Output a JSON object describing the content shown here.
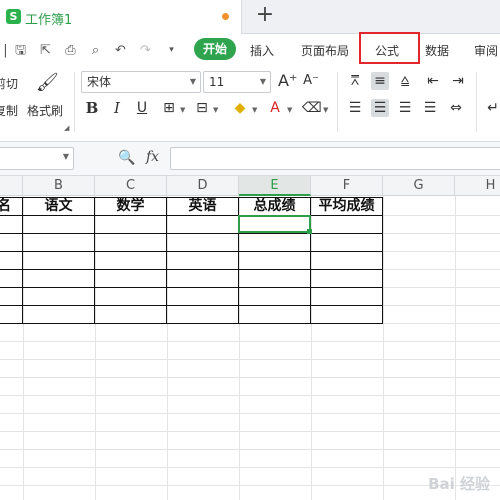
{
  "document": {
    "title": "工作簿1",
    "icon_letter": "S"
  },
  "tabbar": {
    "new_tab_label": "+"
  },
  "menu": {
    "start_label": "开始",
    "tabs": [
      "插入",
      "页面布局",
      "公式",
      "数据",
      "审阅"
    ]
  },
  "ribbon": {
    "cut_label": "剪切",
    "copy_label": "复制",
    "format_painter_label": "格式刷",
    "font_name": "宋体",
    "font_size": "11"
  },
  "formula_bar": {
    "fx_label": "fx",
    "value": ""
  },
  "columns": [
    "B",
    "C",
    "D",
    "E",
    "F",
    "G",
    "H"
  ],
  "selected_column": "E",
  "table": {
    "headers": [
      "语文",
      "数学",
      "英语",
      "总成绩",
      "平均成绩"
    ],
    "partial_header": "名"
  },
  "watermark": "Bai 经验",
  "colors": {
    "accent": "#2ea44f",
    "highlight": "#e3262c",
    "selected": "#2e9e4a"
  }
}
